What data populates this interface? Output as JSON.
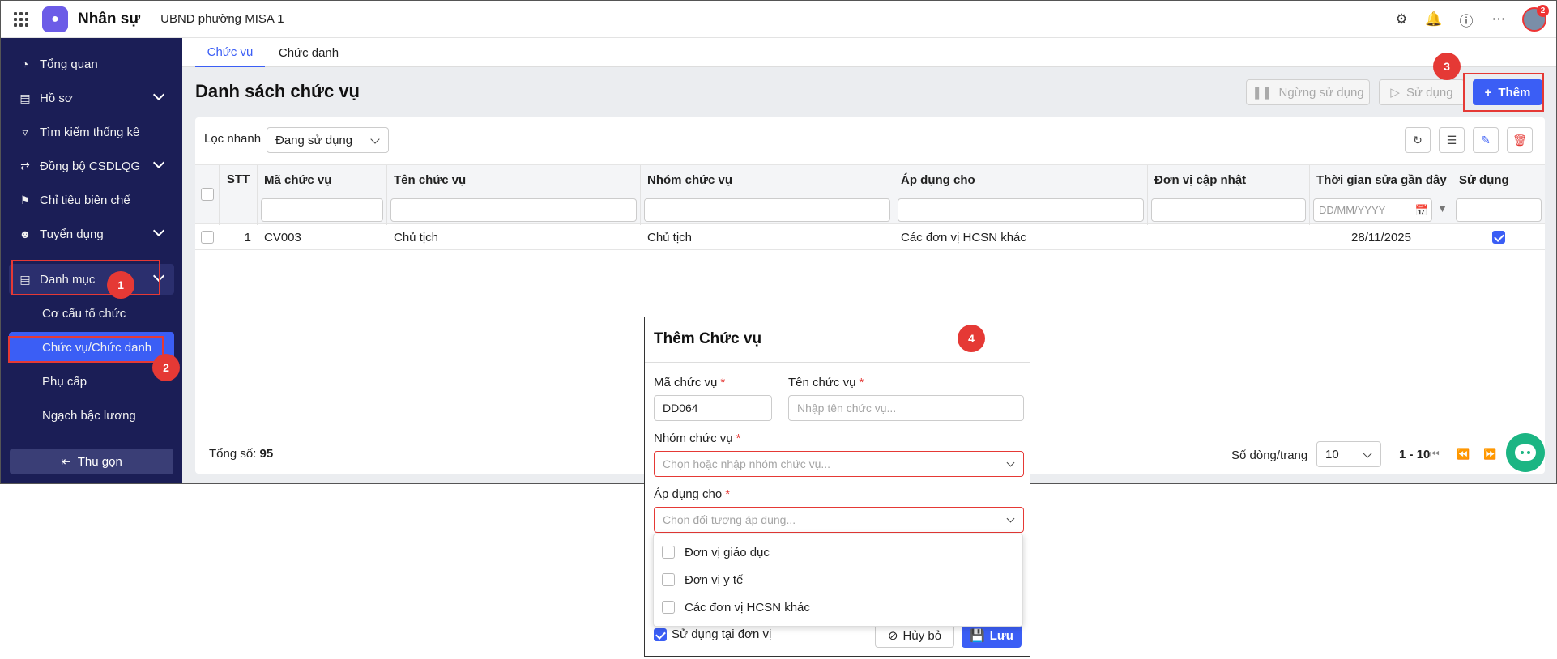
{
  "topbar": {
    "app_name": "Nhân sự",
    "org_name": "UBND phường MISA 1",
    "notification_count": "2",
    "icons": [
      "apps-grid-icon",
      "settings-icon",
      "bell-icon",
      "help-icon",
      "more-icon"
    ]
  },
  "sidebar": {
    "items": [
      {
        "label": "Tổng quan",
        "icon": "chart-pie-icon"
      },
      {
        "label": "Hồ sơ",
        "icon": "id-card-icon"
      },
      {
        "label": "Tìm kiếm thống kê",
        "icon": "filter-icon"
      },
      {
        "label": "Đồng bộ CSDLQG",
        "icon": "sync-icon"
      },
      {
        "label": "Chỉ tiêu biên chế",
        "icon": "flag-icon"
      },
      {
        "label": "Tuyển dụng",
        "icon": "user-search-icon"
      },
      {
        "label": "Danh mục",
        "icon": "document-icon"
      }
    ],
    "sub_items": [
      {
        "label": "Cơ cấu tổ chức"
      },
      {
        "label": "Chức vụ/Chức danh"
      },
      {
        "label": "Phụ cấp"
      },
      {
        "label": "Ngạch bậc lương"
      }
    ],
    "collapse_label": "Thu gọn"
  },
  "tabs": [
    {
      "label": "Chức vụ"
    },
    {
      "label": "Chức danh"
    }
  ],
  "page": {
    "title": "Danh sách chức vụ",
    "btn_stop": "Ngừng sử dụng",
    "btn_use": "Sử dụng",
    "btn_add": "Thêm"
  },
  "filter": {
    "label": "Lọc nhanh",
    "value": "Đang sử dụng"
  },
  "table": {
    "columns": [
      "STT",
      "Mã chức vụ",
      "Tên chức vụ",
      "Nhóm chức vụ",
      "Áp dụng cho",
      "Đơn vị cập nhật",
      "Thời gian sửa gần đây",
      "Sử dụng"
    ],
    "date_placeholder": "DD/MM/YYYY",
    "rows": [
      {
        "stt": "1",
        "ma": "CV003",
        "ten": "Chủ tịch",
        "nhom": "Chủ tịch",
        "ap_dung": "Các đơn vị HCSN khác",
        "don_vi": "",
        "thoi_gian": "28/11/2025",
        "su_dung": true
      }
    ]
  },
  "footer": {
    "total_label": "Tổng số:",
    "total_value": "95",
    "rows_per_page_label": "Số dòng/trang",
    "rows_per_page": "10",
    "range_start": "1",
    "range_sep": "-",
    "range_end": "10"
  },
  "markers": [
    "1",
    "2",
    "3",
    "4"
  ],
  "modal": {
    "title": "Thêm Chức vụ",
    "code_label": "Mã chức vụ",
    "code_value": "DD064",
    "name_label": "Tên chức vụ",
    "name_placeholder": "Nhập tên chức vụ...",
    "group_label": "Nhóm chức vụ",
    "group_placeholder": "Chọn hoặc nhập nhóm chức vụ...",
    "apply_label": "Áp dụng cho",
    "apply_placeholder": "Chọn đối tượng áp dụng...",
    "apply_options": [
      "Đơn vị giáo dục",
      "Đơn vị y tế",
      "Các đơn vị HCSN khác"
    ],
    "use_at_unit_label": "Sử dụng tại đơn vị",
    "cancel_label": "Hủy bỏ",
    "save_label": "Lưu",
    "required_mark": "*"
  },
  "colors": {
    "primary": "#3b5ef5",
    "sidebar": "#1b1e56",
    "marker": "#e53935",
    "chat": "#1bb583"
  }
}
